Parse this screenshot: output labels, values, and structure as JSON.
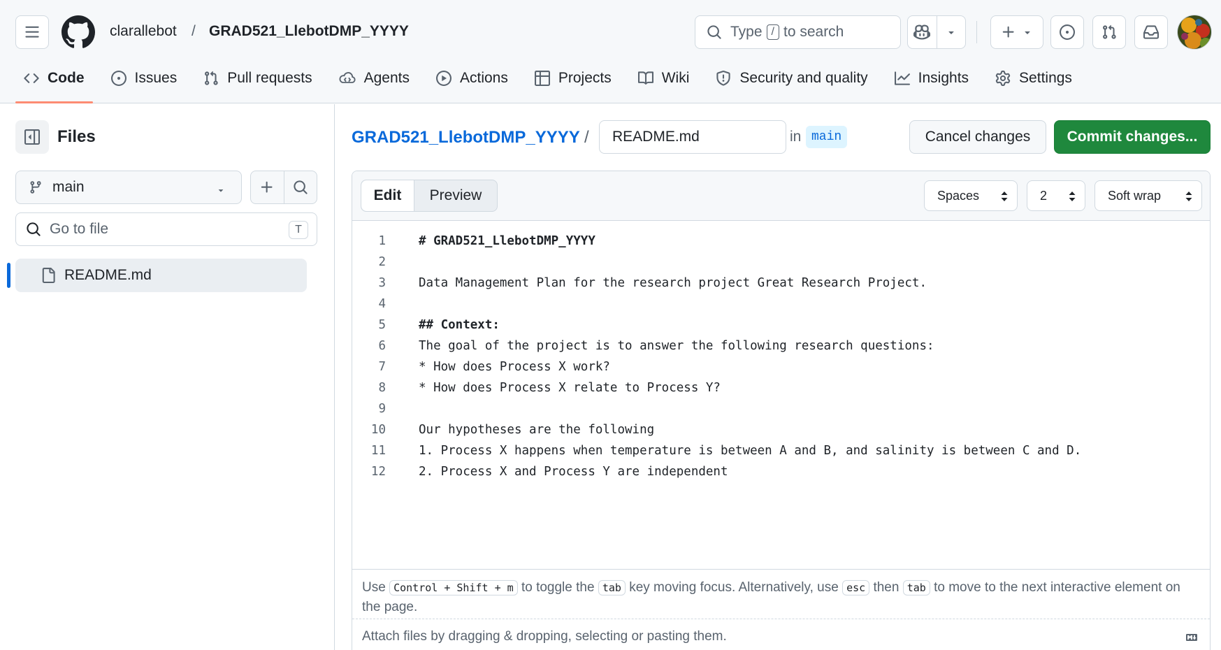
{
  "header": {
    "owner": "clarallebot",
    "separator": "/",
    "repo": "GRAD521_LlebotDMP_YYYY",
    "search": {
      "prefix": "Type",
      "key": "/",
      "suffix": "to search"
    }
  },
  "repo_nav": {
    "items": [
      {
        "label": "Code",
        "icon": "code-icon",
        "active": true
      },
      {
        "label": "Issues",
        "icon": "issue-opened-icon"
      },
      {
        "label": "Pull requests",
        "icon": "git-pull-request-icon"
      },
      {
        "label": "Agents",
        "icon": "agent-icon"
      },
      {
        "label": "Actions",
        "icon": "play-icon"
      },
      {
        "label": "Projects",
        "icon": "table-icon"
      },
      {
        "label": "Wiki",
        "icon": "book-icon"
      },
      {
        "label": "Security and quality",
        "icon": "shield-icon"
      },
      {
        "label": "Insights",
        "icon": "graph-icon"
      },
      {
        "label": "Settings",
        "icon": "gear-icon"
      }
    ]
  },
  "sidebar": {
    "title": "Files",
    "branch": "main",
    "goto_placeholder": "Go to file",
    "goto_shortcut": "T",
    "files": [
      {
        "name": "README.md",
        "icon": "file-icon",
        "selected": true
      }
    ]
  },
  "editor_header": {
    "repo_link": "GRAD521_LlebotDMP_YYYY",
    "separator": "/",
    "filename": "README.md",
    "in_label": "in",
    "branch": "main",
    "cancel_label": "Cancel changes",
    "commit_label": "Commit changes..."
  },
  "editor": {
    "tabs": {
      "edit": "Edit",
      "preview": "Preview"
    },
    "indent_mode": "Spaces",
    "indent_size": "2",
    "wrap_mode": "Soft wrap",
    "lines": [
      {
        "n": "1",
        "text": "# GRAD521_LlebotDMP_YYYY",
        "bold": true
      },
      {
        "n": "2",
        "text": ""
      },
      {
        "n": "3",
        "text": "Data Management Plan for the research project Great Research Project."
      },
      {
        "n": "4",
        "text": ""
      },
      {
        "n": "5",
        "text": "## Context:",
        "bold": true
      },
      {
        "n": "6",
        "text": "The goal of the project is to answer the following research questions:"
      },
      {
        "n": "7",
        "text": "* How does Process X work?"
      },
      {
        "n": "8",
        "text": "* How does Process X relate to Process Y?"
      },
      {
        "n": "9",
        "text": ""
      },
      {
        "n": "10",
        "text": "Our hypotheses are the following"
      },
      {
        "n": "11",
        "text": "1. Process X happens when temperature is between A and B, and salinity is between C and D."
      },
      {
        "n": "12",
        "text": "2. Process X and Process Y are independent"
      }
    ],
    "hint": {
      "use": "Use",
      "combo": "Control + Shift + m",
      "toggle": "to toggle the",
      "tab_key": "tab",
      "rest1": "key moving focus. Alternatively, use",
      "esc_key": "esc",
      "then": "then",
      "tab_key2": "tab",
      "rest2": "to move to the next interactive element on the page."
    },
    "attach": "Attach files by dragging & dropping, selecting or pasting them."
  }
}
